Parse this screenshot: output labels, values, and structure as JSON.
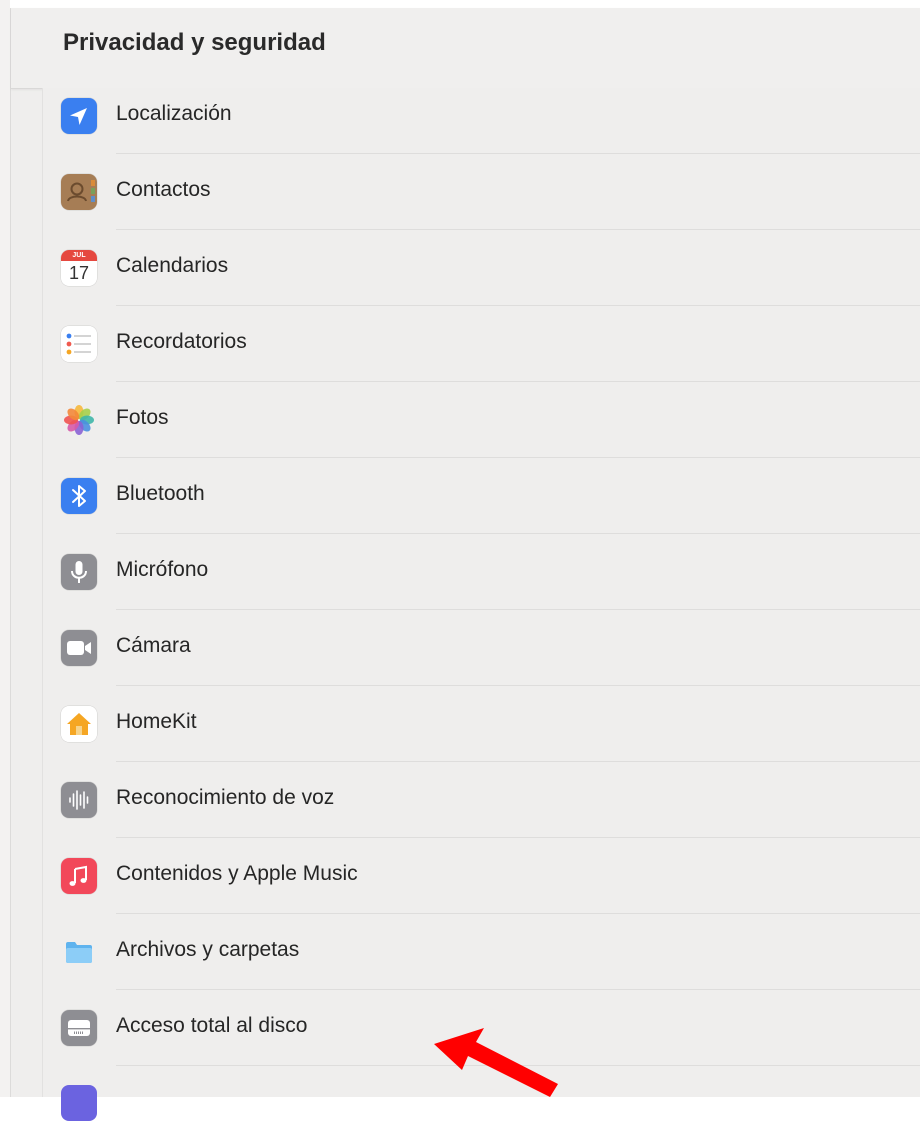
{
  "header": {
    "title": "Privacidad y seguridad"
  },
  "items": [
    {
      "label": "Localización"
    },
    {
      "label": "Contactos"
    },
    {
      "label": "Calendarios",
      "calendar_month": "JUL",
      "calendar_day": "17"
    },
    {
      "label": "Recordatorios"
    },
    {
      "label": "Fotos"
    },
    {
      "label": "Bluetooth"
    },
    {
      "label": "Micrófono"
    },
    {
      "label": "Cámara"
    },
    {
      "label": "HomeKit"
    },
    {
      "label": "Reconocimiento de voz"
    },
    {
      "label": "Contenidos y Apple Music"
    },
    {
      "label": "Archivos y carpetas"
    },
    {
      "label": "Acceso total al disco"
    }
  ],
  "colors": {
    "accent_blue": "#3a7ff0",
    "annotation_arrow": "#ff0000"
  }
}
